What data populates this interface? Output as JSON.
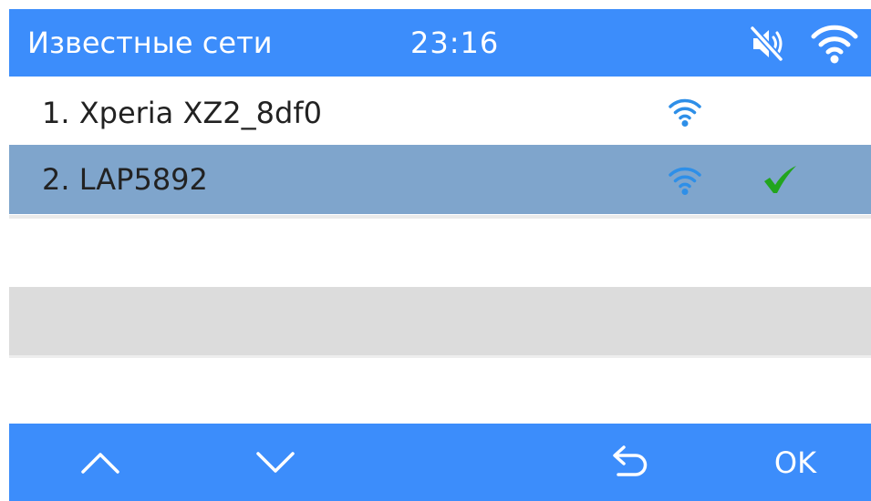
{
  "status_bar": {
    "title": "Известные сети",
    "time": "23:16",
    "icons": [
      "mute-icon",
      "wifi-icon"
    ],
    "bar_color": "#3c8dfb"
  },
  "networks": [
    {
      "label": "1. Xperia XZ2_8df0",
      "signal_icon": "wifi-icon",
      "connected": false,
      "selected": false
    },
    {
      "label": "2. LAP5892",
      "signal_icon": "wifi-icon",
      "connected": true,
      "selected": true
    }
  ],
  "colors": {
    "accent": "#3c8dfb",
    "selection": "#7fa5cc",
    "signal": "#2e8fe8",
    "check": "#22a51e"
  },
  "footer": {
    "up_icon": "chevron-up-icon",
    "down_icon": "chevron-down-icon",
    "back_icon": "back-arrow-icon",
    "ok_label": "OK"
  }
}
